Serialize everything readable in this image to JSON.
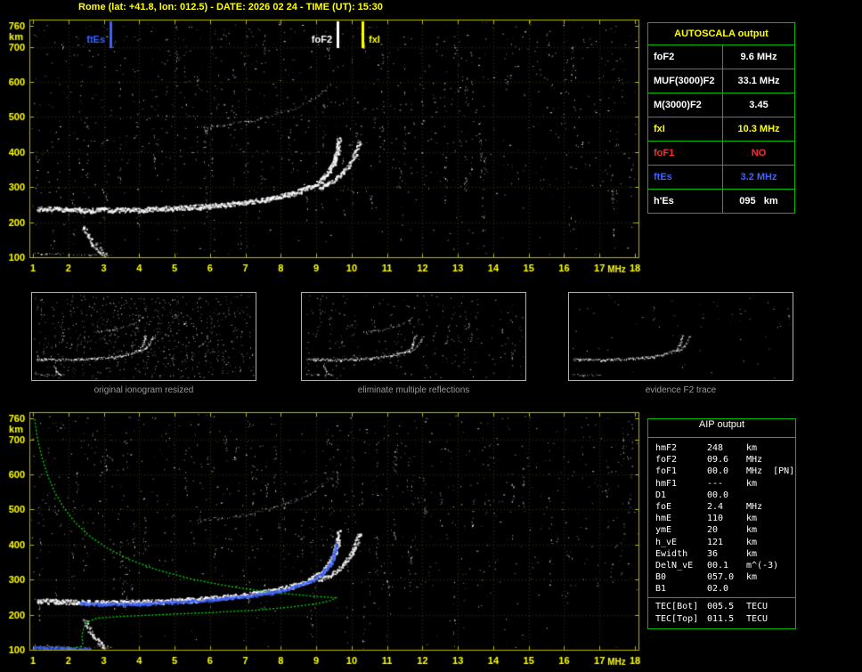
{
  "colors": {
    "yellow": "#ffff00",
    "border_yellow": "#b8b800",
    "green": "#00bb00",
    "bright_green": "#00dd00",
    "blue": "#3b62ff",
    "red": "#ff2a2a",
    "white": "#ffffff",
    "gray": "#9a9a9a",
    "panel_border": "#b0b0b0",
    "bg": "#000000"
  },
  "header": {
    "title": "Rome (lat: +41.8, lon: 012.5) - DATE: 2026 02 24 - TIME (UT): 15:30"
  },
  "autoscala": {
    "title": "AUTOSCALA output",
    "rows": [
      {
        "label": "foF2",
        "value": "9.6 MHz",
        "color": "white"
      },
      {
        "label": "MUF(3000)F2",
        "value": "33.1 MHz",
        "color": "white"
      },
      {
        "label": "M(3000)F2",
        "value": "3.45",
        "color": "white"
      },
      {
        "label": "fxI",
        "value": "10.3 MHz",
        "color": "yellow"
      },
      {
        "label": "foF1",
        "value": "NO",
        "color": "red"
      },
      {
        "label": "ftEs",
        "value": "3.2 MHz",
        "color": "blue"
      },
      {
        "label": "h'Es",
        "value": "095   km",
        "color": "white"
      }
    ]
  },
  "panels": [
    {
      "caption": "original ionogram resized"
    },
    {
      "caption": "eliminate multiple reflections"
    },
    {
      "caption": "evidence F2 trace"
    }
  ],
  "aip": {
    "title": "AIP output",
    "rows": [
      {
        "label": "hmF2",
        "value": "248",
        "unit": "km"
      },
      {
        "label": "foF2",
        "value": "09.6",
        "unit": "MHz"
      },
      {
        "label": "foF1",
        "value": "00.0",
        "unit": "MHz  [PN]"
      },
      {
        "label": "hmF1",
        "value": "---",
        "unit": "km"
      },
      {
        "label": "D1",
        "value": "00.0",
        "unit": ""
      },
      {
        "label": "foE",
        "value": "2.4",
        "unit": "MHz"
      },
      {
        "label": "hmE",
        "value": "110",
        "unit": "km"
      },
      {
        "label": "ymE",
        "value": "20",
        "unit": "km"
      },
      {
        "label": "h_vE",
        "value": "121",
        "unit": "km"
      },
      {
        "label": "Ewidth",
        "value": "36",
        "unit": "km"
      },
      {
        "label": "DelN_vE",
        "value": "00.1",
        "unit": "m^(-3)"
      },
      {
        "label": "B0",
        "value": "057.0",
        "unit": "km"
      },
      {
        "label": "B1",
        "value": "02.0",
        "unit": ""
      }
    ],
    "tec_rows": [
      {
        "label": "TEC[Bot]",
        "value": "005.5",
        "unit": "TECU"
      },
      {
        "label": "TEC[Top]",
        "value": "011.5",
        "unit": "TECU"
      }
    ]
  },
  "chart_data": {
    "type": "scatter",
    "x_axis": {
      "label": "MHz",
      "range": [
        1,
        18
      ],
      "ticks": [
        1,
        2,
        3,
        4,
        5,
        6,
        7,
        8,
        9,
        10,
        11,
        12,
        13,
        14,
        15,
        16,
        17,
        18
      ]
    },
    "y_axis": {
      "label": "km",
      "range": [
        90,
        780
      ],
      "ticks": [
        100,
        200,
        300,
        400,
        500,
        600,
        700,
        760
      ]
    },
    "markers": [
      {
        "label": "ftEs",
        "freq_mhz": 3.2,
        "color": "blue",
        "label_side": "left"
      },
      {
        "label": "foF2",
        "freq_mhz": 9.6,
        "color": "white",
        "label_side": "left"
      },
      {
        "label": "fxI",
        "freq_mhz": 10.3,
        "color": "yellow",
        "label_side": "right"
      }
    ],
    "traces": {
      "f2_ordinary": [
        [
          1.1,
          241
        ],
        [
          1.7,
          239
        ],
        [
          2.3,
          237
        ],
        [
          3.0,
          236
        ],
        [
          3.8,
          237
        ],
        [
          4.6,
          240
        ],
        [
          5.4,
          244
        ],
        [
          6.2,
          250
        ],
        [
          7.0,
          258
        ],
        [
          7.7,
          269
        ],
        [
          8.3,
          283
        ],
        [
          8.8,
          300
        ],
        [
          9.15,
          322
        ],
        [
          9.38,
          350
        ],
        [
          9.52,
          382
        ],
        [
          9.6,
          415
        ],
        [
          9.64,
          442
        ]
      ],
      "f2_extraordinary": [
        [
          9.05,
          298
        ],
        [
          9.45,
          318
        ],
        [
          9.75,
          342
        ],
        [
          9.95,
          372
        ],
        [
          10.1,
          402
        ],
        [
          10.2,
          432
        ]
      ],
      "f2_multiple": [
        [
          5.6,
          470
        ],
        [
          6.2,
          476
        ],
        [
          6.8,
          484
        ],
        [
          7.4,
          496
        ],
        [
          7.9,
          510
        ],
        [
          8.4,
          527
        ],
        [
          8.8,
          547
        ],
        [
          9.15,
          570
        ],
        [
          9.4,
          594
        ]
      ],
      "es_layer": [
        [
          1.0,
          113
        ],
        [
          1.5,
          111
        ],
        [
          2.0,
          109
        ],
        [
          2.6,
          108
        ],
        [
          3.2,
          107
        ]
      ],
      "es_spread": [
        [
          2.45,
          192
        ],
        [
          2.55,
          163
        ],
        [
          2.7,
          140
        ],
        [
          2.88,
          120
        ],
        [
          3.05,
          107
        ]
      ]
    },
    "profile_green": [
      [
        1.05,
        758
      ],
      [
        1.12,
        706
      ],
      [
        1.25,
        650
      ],
      [
        1.42,
        596
      ],
      [
        1.62,
        548
      ],
      [
        1.88,
        504
      ],
      [
        2.2,
        462
      ],
      [
        2.6,
        424
      ],
      [
        3.1,
        390
      ],
      [
        3.7,
        358
      ],
      [
        4.5,
        328
      ],
      [
        5.5,
        301
      ],
      [
        6.7,
        278
      ],
      [
        7.9,
        262
      ],
      [
        8.9,
        253
      ],
      [
        9.55,
        248
      ],
      [
        9.4,
        240
      ],
      [
        9.0,
        231
      ],
      [
        8.3,
        222
      ],
      [
        7.3,
        213
      ],
      [
        6.0,
        206
      ],
      [
        4.6,
        200
      ],
      [
        3.5,
        195
      ],
      [
        2.8,
        190
      ],
      [
        2.55,
        180
      ],
      [
        2.45,
        166
      ],
      [
        2.4,
        150
      ],
      [
        2.38,
        134
      ],
      [
        2.42,
        120
      ],
      [
        2.36,
        110
      ],
      [
        2.1,
        103
      ],
      [
        1.6,
        97
      ],
      [
        1.2,
        94
      ]
    ],
    "blue_trace": [
      [
        2.3,
        241
      ],
      [
        3.0,
        239
      ],
      [
        3.8,
        240
      ],
      [
        4.6,
        243
      ],
      [
        5.4,
        247
      ],
      [
        6.2,
        253
      ],
      [
        7.0,
        261
      ],
      [
        7.7,
        272
      ],
      [
        8.3,
        286
      ],
      [
        8.8,
        303
      ],
      [
        9.15,
        325
      ],
      [
        9.38,
        353
      ],
      [
        9.5,
        385
      ],
      [
        9.56,
        410
      ]
    ],
    "blue_es": [
      [
        1.0,
        109
      ],
      [
        1.5,
        107
      ],
      [
        2.1,
        105
      ],
      [
        2.6,
        104
      ]
    ]
  }
}
